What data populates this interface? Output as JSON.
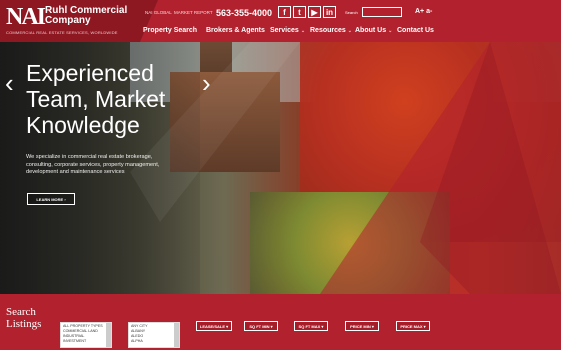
{
  "header": {
    "logo": {
      "mark": "NAI",
      "name_line1": "Ruhl Commercial",
      "name_line2": "Company",
      "tagline": "COMMERCIAL REAL ESTATE SERVICES, WORLDWIDE"
    },
    "util_links": [
      "NAI GLOBAL",
      "MARKET REPORT"
    ],
    "phone": "563-355-4000",
    "social": [
      "f",
      "t",
      "▶",
      "in"
    ],
    "search_label": "Search",
    "search_value": "",
    "text_size": "A+ a-"
  },
  "nav": [
    {
      "label": "Property Search",
      "chev": ""
    },
    {
      "label": "Brokers & Agents",
      "chev": ""
    },
    {
      "label": "Services",
      "chev": "⌄"
    },
    {
      "label": "Resources",
      "chev": "⌄"
    },
    {
      "label": "About Us",
      "chev": "⌄"
    },
    {
      "label": "Contact Us",
      "chev": ""
    }
  ],
  "hero": {
    "title_line1": "Experienced",
    "title_line2": "Team, Market",
    "title_line3": "Knowledge",
    "text": "We specialize in commercial real estate brokerage, consulting, corporate services, property management, development and maintenance services",
    "button": "LEARN MORE ›",
    "prev": "‹",
    "next": "›"
  },
  "search": {
    "title_line1": "Search",
    "title_line2": "Listings",
    "property_types": [
      "ALL PROPERTY TYPES",
      "COMMERCIAL LAND",
      "INDUSTRIAL",
      "INVESTMENT"
    ],
    "cities": [
      "ANY CITY",
      "ALBANY",
      "ALEDO",
      "ALPHA"
    ],
    "dropdowns": [
      "LEASE/SALE ▾",
      "SQ FT MIN ▾",
      "SQ FT MAX ▾",
      "PRICE MIN ▾",
      "PRICE MAX ▾"
    ]
  },
  "colors": {
    "brand_red": "#b1212e",
    "dark_red": "#8e1822"
  }
}
